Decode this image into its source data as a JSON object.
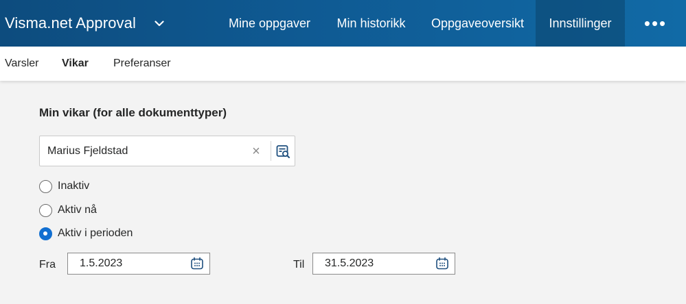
{
  "header": {
    "brand": "Visma.net Approval",
    "nav": [
      {
        "label": "Mine oppgaver"
      },
      {
        "label": "Min historikk"
      },
      {
        "label": "Oppgaveoversikt"
      },
      {
        "label": "Innstillinger",
        "active": true
      }
    ],
    "more_label": "•••"
  },
  "subnav": {
    "tabs": [
      {
        "label": "Varsler"
      },
      {
        "label": "Vikar",
        "active": true
      },
      {
        "label": "Preferanser"
      }
    ]
  },
  "main": {
    "section_title": "Min vikar (for alle dokumenttyper)",
    "substitute": {
      "value": "Marius Fjeldstad",
      "clear_glyph": "×"
    },
    "status_options": [
      {
        "label": "Inaktiv",
        "checked": false
      },
      {
        "label": "Aktiv nå",
        "checked": false
      },
      {
        "label": "Aktiv i perioden",
        "checked": true
      }
    ],
    "period": {
      "from_label": "Fra",
      "from_value": "1.5.2023",
      "to_label": "Til",
      "to_value": "31.5.2023"
    }
  },
  "colors": {
    "header": "#0f5a93",
    "accent": "#116fd1",
    "icon": "#1e4f7e"
  }
}
